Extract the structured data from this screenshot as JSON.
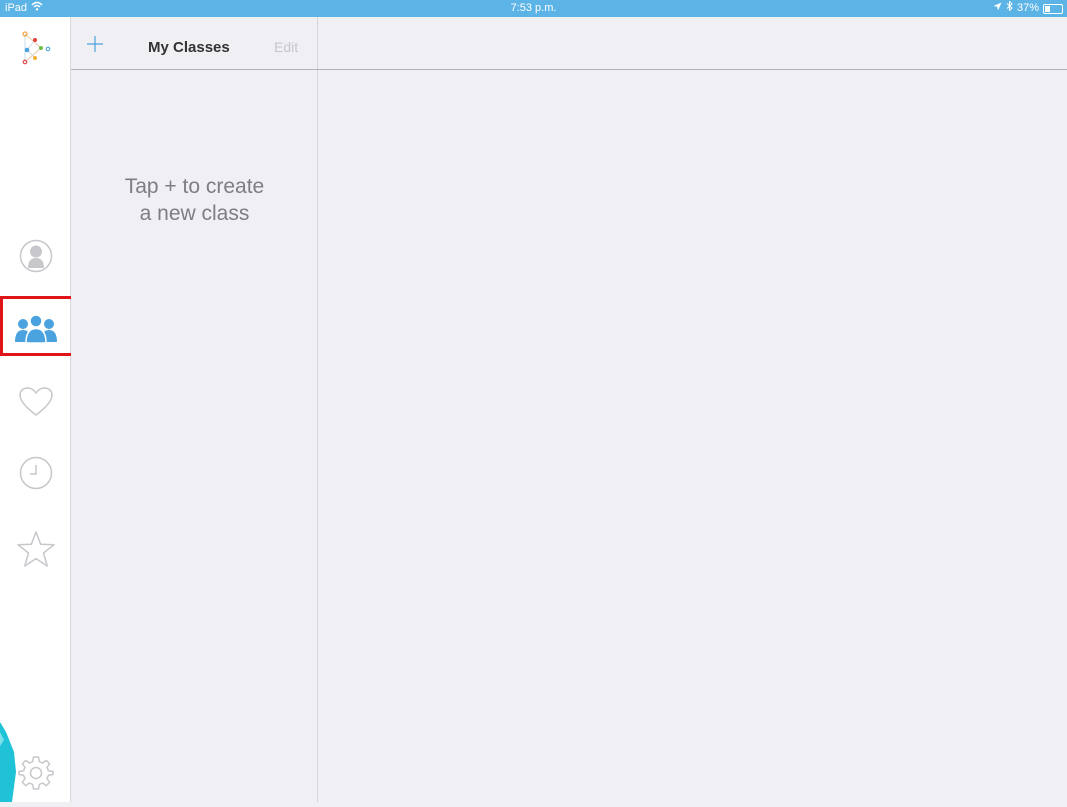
{
  "status_bar": {
    "device": "iPad",
    "time": "7:53 p.m.",
    "battery": "37%",
    "battery_level": 0.37,
    "icons": [
      "wifi-icon",
      "location-arrow-icon",
      "bluetooth-icon",
      "battery-icon"
    ]
  },
  "sidebar": {
    "items": [
      {
        "name": "profile",
        "icon": "person-circle-icon"
      },
      {
        "name": "classes",
        "icon": "group-icon",
        "selected": true
      },
      {
        "name": "favorites",
        "icon": "heart-icon"
      },
      {
        "name": "history",
        "icon": "clock-icon"
      },
      {
        "name": "starred",
        "icon": "star-icon"
      },
      {
        "name": "settings",
        "icon": "gear-icon"
      }
    ]
  },
  "nav": {
    "add_icon": "plus-icon",
    "title": "My Classes",
    "edit_label": "Edit"
  },
  "empty_state": {
    "line1": "Tap + to create",
    "line2": "a new class"
  },
  "colors": {
    "status_bar": "#5bb4e5",
    "accent": "#4aa3df",
    "icon_gray": "#c7c7cc",
    "highlight": "#e0151a"
  }
}
